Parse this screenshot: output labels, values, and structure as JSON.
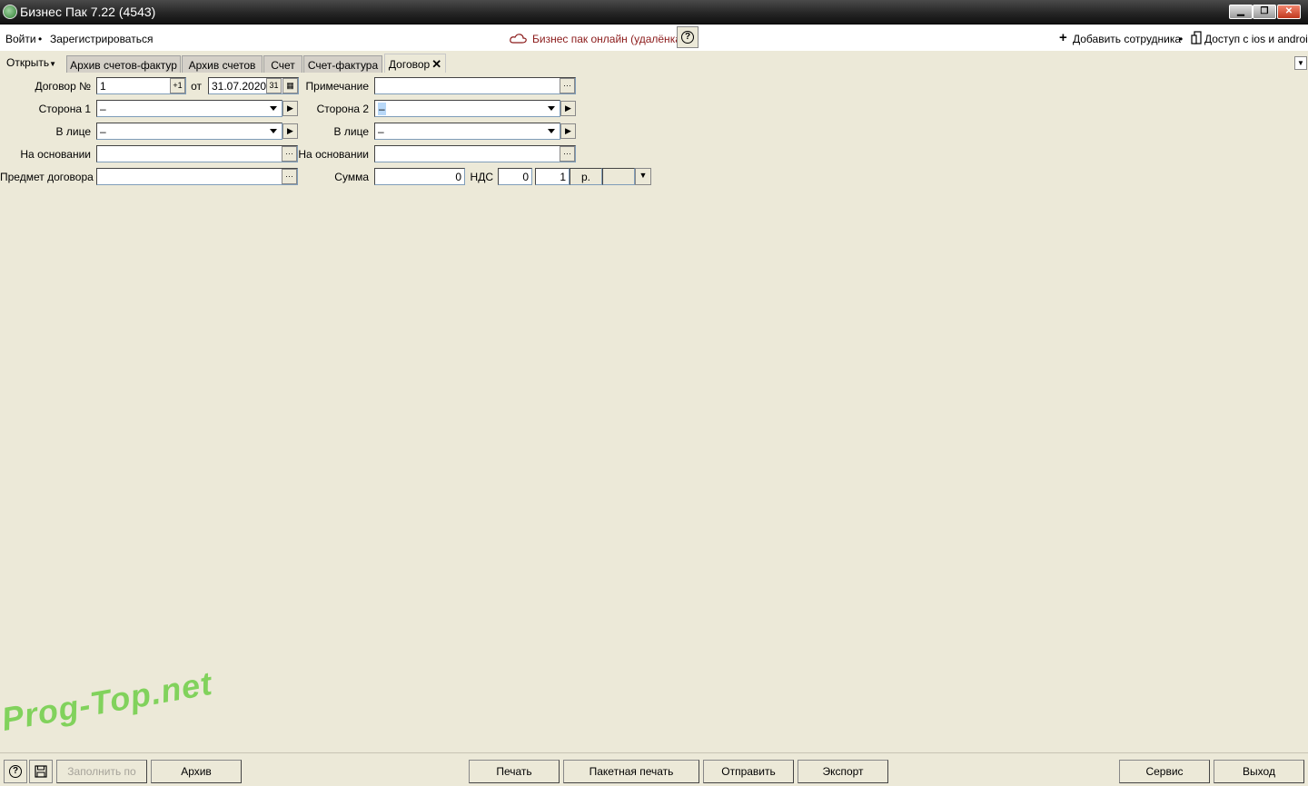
{
  "window": {
    "title": "Бизнес Пак 7.22 (4543)",
    "minimize": "▁",
    "restore": "❐",
    "close": "✕"
  },
  "menubar": {
    "login": "Войти",
    "separator": "•",
    "register": "Зарегистрироваться",
    "online": "Бизнес пак онлайн (удалёнка)",
    "help": "?",
    "add_employee": "Добавить сотрудника",
    "separator2": "•",
    "mobile_access": "Доступ с ios и android"
  },
  "tabs": {
    "open": "Открыть",
    "items": [
      {
        "label": "Архив счетов-фактур"
      },
      {
        "label": "Архив счетов"
      },
      {
        "label": "Счет"
      },
      {
        "label": "Счет-фактура"
      },
      {
        "label": "Договор"
      }
    ],
    "close_symbol": "✕"
  },
  "form": {
    "contract_no_label": "Договор №",
    "contract_no_value": "1",
    "increment_button": "+1",
    "from_label": "от",
    "date_value": "31.07.2020",
    "day_button": "31",
    "note_label": "Примечание",
    "note_value": "",
    "side1_label": "Сторона 1",
    "side1_value": "–",
    "side2_label": "Сторона 2",
    "side2_value": "–",
    "person1_label": "В лице",
    "person1_value": "–",
    "person2_label": "В лице",
    "person2_value": "–",
    "basis1_label": "На основании",
    "basis1_value": "",
    "basis2_label": "На основании",
    "basis2_value": "",
    "subject_label": "Предмет договора",
    "subject_value": "",
    "sum_label": "Сумма",
    "sum_value": "0",
    "vat_label": "НДС",
    "vat_value": "0",
    "rate_value": "1",
    "currency": "р.",
    "ellipsis": "···",
    "arrow": "▶"
  },
  "bottom": {
    "fill_from": "Заполнить по",
    "archive": "Архив",
    "print": "Печать",
    "batch_print": "Пакетная печать",
    "send": "Отправить",
    "export": "Экспорт",
    "service": "Сервис",
    "exit": "Выход"
  },
  "watermark": "Prog-Top.net"
}
